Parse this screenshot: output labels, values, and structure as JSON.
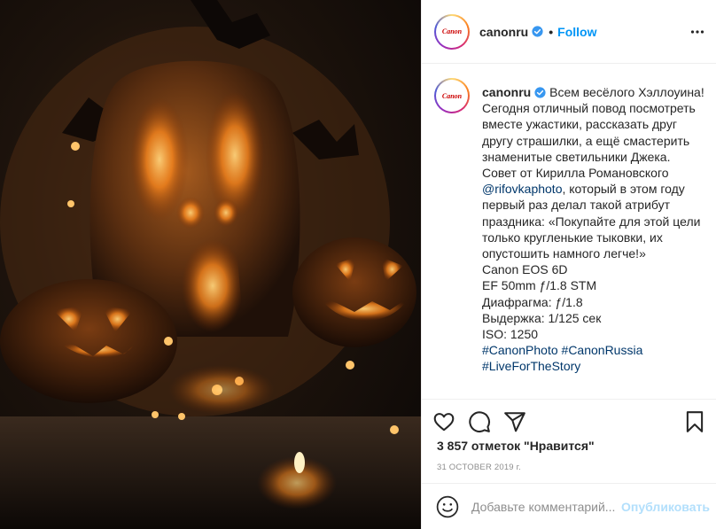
{
  "post": {
    "image_alt": "",
    "author": {
      "username": "canonru",
      "logo_text": "Canon",
      "verified": true
    },
    "header": {
      "separator": "•",
      "follow_label": "Follow"
    },
    "caption": {
      "username": "canonru",
      "line1_text": " Всем весёлого Хэллоуина! Сегодня отличный повод посмотреть вместе ужастики, рассказать друг другу страшилки, а ещё смастерить знаменитые светильники Джека. Совет от Кирилла Романовского ",
      "mention": "@rifovkaphoto",
      "body": ", который в этом году первый раз делал такой атрибут праздника: «Покупайте для этой цели только кругленькие тыковки, их опустошить намного легче!»",
      "camera": "Canon EOS 6D",
      "lens": "EF 50mm ƒ/1.8 STM",
      "aperture": "Диафрагма: ƒ/1.8",
      "exposure": "Выдержка: 1/125 сек",
      "iso": "ISO: 1250",
      "hashtag1": "#CanonPhoto",
      "hashtag2": "#CanonRussia",
      "hashtag3": "#LiveForTheStory"
    },
    "actions": {
      "like": "heart-icon",
      "comment": "comment-icon",
      "share": "share-icon",
      "save": "bookmark-icon"
    },
    "likes_text": "3 857 отметок \"Нравится\"",
    "date_text": "31 OCTOBER 2019 г.",
    "comment": {
      "placeholder": "Добавьте комментарий...",
      "publish_label": "Опубликовать"
    },
    "colors": {
      "follow": "#0095f6",
      "verified": "#3897f0",
      "hashtag": "#00376b",
      "publish_disabled": "#b2dffc"
    }
  }
}
